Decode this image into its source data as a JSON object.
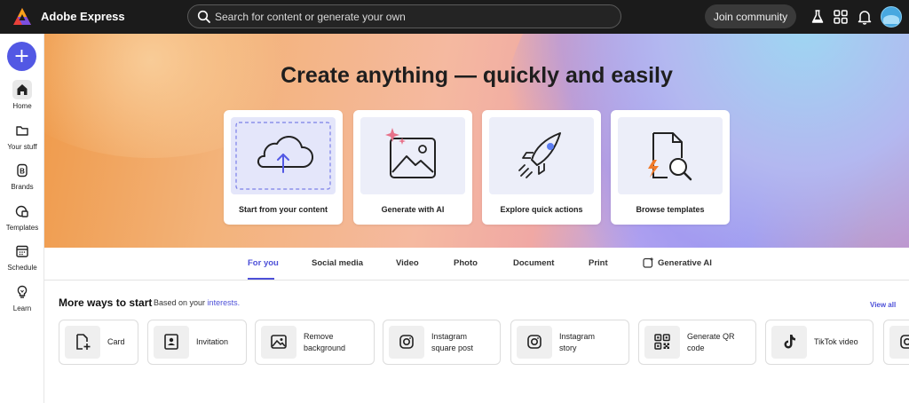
{
  "app": {
    "title": "Adobe Express"
  },
  "search": {
    "placeholder": "Search for content or generate your own"
  },
  "header": {
    "join_label": "Join community"
  },
  "sidebar": {
    "create_label": "+",
    "items": [
      {
        "label": "Home",
        "icon": "home-icon"
      },
      {
        "label": "Your stuff",
        "icon": "folder-icon"
      },
      {
        "label": "Brands",
        "icon": "brand-icon"
      },
      {
        "label": "Templates",
        "icon": "templates-icon"
      },
      {
        "label": "Schedule",
        "icon": "calendar-icon"
      },
      {
        "label": "Learn",
        "icon": "lightbulb-icon"
      }
    ]
  },
  "hero": {
    "title": "Create anything — quickly and easily",
    "cards": [
      {
        "label": "Start from your content",
        "icon": "cloud-upload-icon"
      },
      {
        "label": "Generate with AI",
        "icon": "ai-image-icon"
      },
      {
        "label": "Explore quick actions",
        "icon": "rocket-icon"
      },
      {
        "label": "Browse templates",
        "icon": "template-search-icon"
      }
    ]
  },
  "tabs": [
    {
      "label": "For you",
      "active": true
    },
    {
      "label": "Social media"
    },
    {
      "label": "Video"
    },
    {
      "label": "Photo"
    },
    {
      "label": "Document"
    },
    {
      "label": "Print"
    },
    {
      "label": "Generative AI"
    }
  ],
  "more": {
    "title": "More ways to start",
    "subtitle": "Based on your",
    "subtitle_link": "interests.",
    "view_all": "View all",
    "items": [
      {
        "label": "Card",
        "icon": "card-icon"
      },
      {
        "label": "Invitation",
        "icon": "invitation-icon"
      },
      {
        "label": "Remove background",
        "icon": "remove-background-icon"
      },
      {
        "label": "Instagram square post",
        "icon": "instagram-icon"
      },
      {
        "label": "Instagram story",
        "icon": "instagram-icon"
      },
      {
        "label": "Generate QR code",
        "icon": "qr-code-icon"
      },
      {
        "label": "TikTok video",
        "icon": "tiktok-icon"
      }
    ]
  },
  "colors": {
    "accent": "#5258e4",
    "link": "#4d50d8",
    "topbar": "#1b1b1b"
  }
}
